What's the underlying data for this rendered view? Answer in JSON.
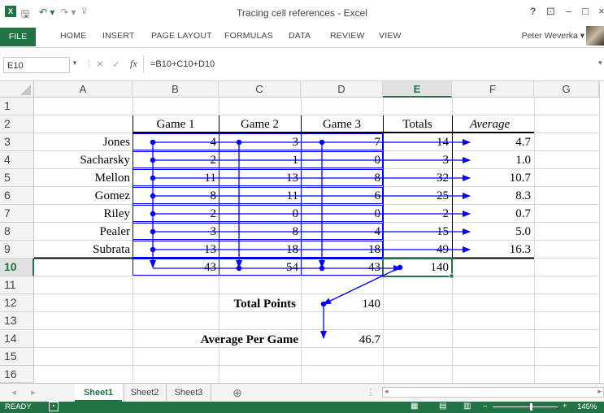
{
  "window": {
    "title": "Tracing cell references - Excel",
    "help": "?",
    "restore": "⊡",
    "minimize": "–",
    "maximize": "□",
    "close": "×"
  },
  "qat": {
    "save": "🖫",
    "undo": "↶ ▾",
    "redo": "↷ ▾",
    "customize": "⊽"
  },
  "ribbon": {
    "file": "FILE",
    "tabs": [
      "HOME",
      "INSERT",
      "PAGE LAYOUT",
      "FORMULAS",
      "DATA",
      "REVIEW",
      "VIEW"
    ],
    "user": "Peter Weverka ▾"
  },
  "formula_bar": {
    "name_box": "E10",
    "cancel": "✕",
    "enter": "✓",
    "fx": "fx",
    "formula": "=B10+C10+D10",
    "expand": "▾"
  },
  "columns": [
    "A",
    "B",
    "C",
    "D",
    "E",
    "F",
    "G"
  ],
  "rows": [
    "1",
    "2",
    "3",
    "4",
    "5",
    "6",
    "7",
    "8",
    "9",
    "10",
    "11",
    "12",
    "13",
    "14",
    "15",
    "16"
  ],
  "selected": {
    "column": "E",
    "row": "10"
  },
  "headers": {
    "game1": "Game 1",
    "game2": "Game 2",
    "game3": "Game 3",
    "totals": "Totals",
    "average": "Average"
  },
  "players": [
    {
      "name": "Jones",
      "g1": "4",
      "g2": "3",
      "g3": "7",
      "total": "14",
      "avg": "4.7"
    },
    {
      "name": "Sacharsky",
      "g1": "2",
      "g2": "1",
      "g3": "0",
      "total": "3",
      "avg": "1.0"
    },
    {
      "name": "Mellon",
      "g1": "11",
      "g2": "13",
      "g3": "8",
      "total": "32",
      "avg": "10.7"
    },
    {
      "name": "Gomez",
      "g1": "8",
      "g2": "11",
      "g3": "6",
      "total": "25",
      "avg": "8.3"
    },
    {
      "name": "Riley",
      "g1": "2",
      "g2": "0",
      "g3": "0",
      "total": "2",
      "avg": "0.7"
    },
    {
      "name": "Pealer",
      "g1": "3",
      "g2": "8",
      "g3": "4",
      "total": "15",
      "avg": "5.0"
    },
    {
      "name": "Subrata",
      "g1": "13",
      "g2": "18",
      "g3": "18",
      "total": "49",
      "avg": "16.3"
    }
  ],
  "sum_row": {
    "g1": "43",
    "g2": "54",
    "g3": "43",
    "total": "140"
  },
  "summary": {
    "total_points_label": "Total Points",
    "total_points": "140",
    "avg_label": "Average Per Game",
    "avg": "46.7"
  },
  "sheets": {
    "tabs": [
      "Sheet1",
      "Sheet2",
      "Sheet3"
    ],
    "active": "Sheet1",
    "add": "⊕"
  },
  "status": {
    "ready": "READY",
    "zoom": "145%"
  },
  "colors": {
    "accent": "#217346",
    "trace": "#0000ff"
  }
}
